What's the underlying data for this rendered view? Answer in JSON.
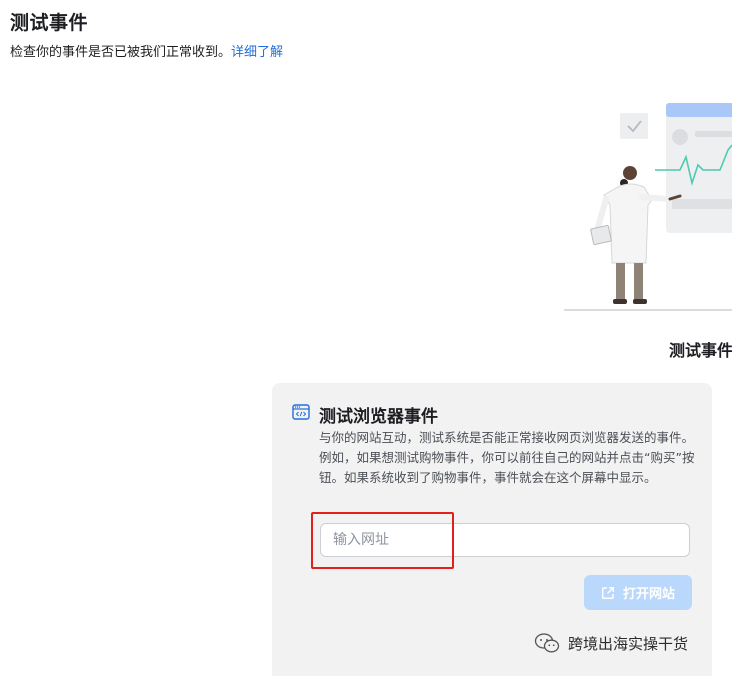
{
  "header": {
    "title": "测试事件",
    "subtitle": "检查你的事件是否已被我们正常收到。",
    "learn_more": "详细了解"
  },
  "illustration": {
    "caption": "测试事件"
  },
  "browser_test": {
    "title": "测试浏览器事件",
    "description": "与你的网站互动，测试系统是否能正常接收网页浏览器发送的事件。例如，如果想测试购物事件，你可以前往自己的网站并点击“购买”按钮。如果系统收到了购物事件，事件就会在这个屏幕中显示。",
    "url_input_value": "",
    "url_input_placeholder": "输入网址",
    "open_button_label": "打开网站",
    "open_button_icon": "external-link-icon"
  },
  "watermark": {
    "text": "跨境出海实操干货",
    "icon": "wechat-icon"
  },
  "colors": {
    "link": "#216fdb",
    "button_disabled": "#b9d8fb",
    "highlight": "#e0201b",
    "card_background": "#f2f2f2"
  }
}
